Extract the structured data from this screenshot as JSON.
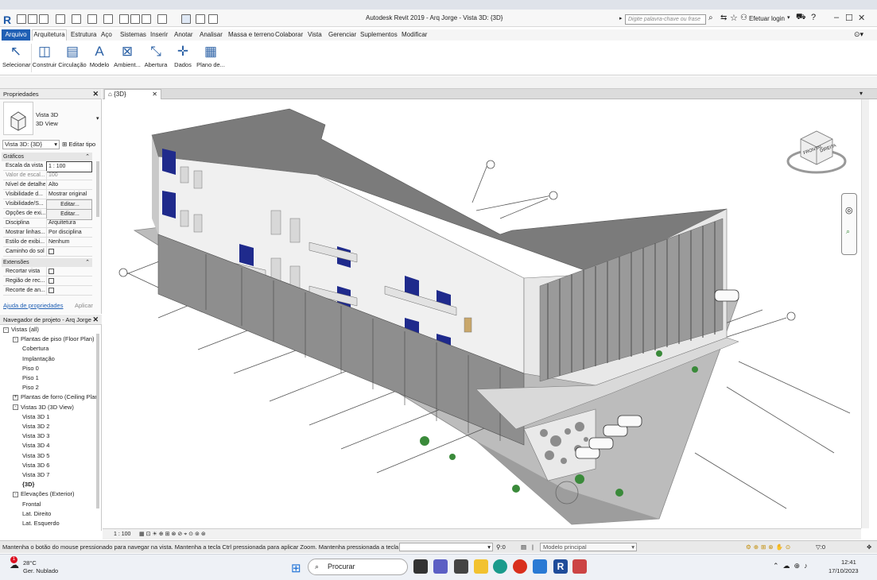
{
  "window": {
    "title": "Autodesk Revit 2019 - Arq Jorge - Vista 3D: {3D}",
    "search_placeholder": "Digite palavra-chave ou frase",
    "login": "Efetuar login"
  },
  "menu": {
    "items": [
      "Arquivo",
      "Arquitetura",
      "Estrutura",
      "Aço",
      "Sistemas",
      "Inserir",
      "Anotar",
      "Analisar",
      "Massa e terreno",
      "Colaborar",
      "Vista",
      "Gerenciar",
      "Suplementos",
      "Modificar"
    ]
  },
  "ribbon": {
    "buttons": [
      {
        "label": "Selecionar",
        "icon": "cursor-icon"
      },
      {
        "label": "Construir",
        "icon": "wall-icon"
      },
      {
        "label": "Circulação",
        "icon": "stair-icon"
      },
      {
        "label": "Modelo",
        "icon": "model-text-icon"
      },
      {
        "label": "Ambient...",
        "icon": "room-icon"
      },
      {
        "label": "Abertura",
        "icon": "opening-icon"
      },
      {
        "label": "Dados",
        "icon": "datum-icon"
      },
      {
        "label": "Plano de...",
        "icon": "work-plane-icon"
      }
    ]
  },
  "properties": {
    "title": "Propriedades",
    "type_name": "Vista 3D",
    "type_sub": "3D View",
    "selector": "Vista 3D: {3D}",
    "edit_type": "Editar tipo",
    "section_graphics": "Gráficos",
    "rows": [
      {
        "k": "Escala da vista",
        "v": "1 : 100"
      },
      {
        "k": "Valor de escal...",
        "v": "100"
      },
      {
        "k": "Nível de detalhe",
        "v": "Alto"
      },
      {
        "k": "Visibilidade d...",
        "v": "Mostrar original"
      },
      {
        "k": "Visibilidade/S...",
        "v": "Editar..."
      },
      {
        "k": "Opções de exi...",
        "v": "Editar..."
      },
      {
        "k": "Disciplina",
        "v": "Arquitetura"
      },
      {
        "k": "Mostrar linhas...",
        "v": "Por disciplina"
      },
      {
        "k": "Estilo de exibi...",
        "v": "Nenhum"
      },
      {
        "k": "Caminho do sol",
        "v": ""
      }
    ],
    "section_extents": "Extensões",
    "ext_rows": [
      "Recortar vista",
      "Região de rec...",
      "Recorte de an..."
    ],
    "help_link": "Ajuda de propriedades",
    "apply": "Aplicar"
  },
  "navigator": {
    "title": "Navegador de projeto - Arq Jorge",
    "tree": [
      {
        "label": "Vistas (all)",
        "level": 0,
        "toggle": "-"
      },
      {
        "label": "Plantas de piso (Floor Plan)",
        "level": 1,
        "toggle": "-"
      },
      {
        "label": "Cobertura",
        "level": 2
      },
      {
        "label": "Implantação",
        "level": 2
      },
      {
        "label": "Piso 0",
        "level": 2
      },
      {
        "label": "Piso 1",
        "level": 2
      },
      {
        "label": "Piso 2",
        "level": 2
      },
      {
        "label": "Plantas de forro (Ceiling Plan",
        "level": 1,
        "toggle": "+"
      },
      {
        "label": "Vistas 3D (3D View)",
        "level": 1,
        "toggle": "-"
      },
      {
        "label": "Vista 3D 1",
        "level": 2
      },
      {
        "label": "Vista 3D 2",
        "level": 2
      },
      {
        "label": "Vista 3D 3",
        "level": 2
      },
      {
        "label": "Vista 3D 4",
        "level": 2
      },
      {
        "label": "Vista 3D 5",
        "level": 2
      },
      {
        "label": "Vista 3D 6",
        "level": 2
      },
      {
        "label": "Vista 3D 7",
        "level": 2
      },
      {
        "label": "{3D}",
        "level": 2,
        "bold": true
      },
      {
        "label": "Elevações (Exterior)",
        "level": 1,
        "toggle": "-"
      },
      {
        "label": "Frontal",
        "level": 2
      },
      {
        "label": "Lat. Direito",
        "level": 2
      },
      {
        "label": "Lat. Esquerdo",
        "level": 2
      }
    ]
  },
  "view": {
    "tab": "{3D}",
    "scale": "1 : 100",
    "viewcube_front": "FRONTAL",
    "viewcube_right": "DIREITA"
  },
  "status": {
    "message": "Mantenha o botão do mouse pressionado para navegar na vista. Mantenha a tecla Ctrl pressionada para aplicar Zoom. Mantenha pressionada a tecla Shift para",
    "selection_count": ":0",
    "model": "Modelo principal",
    "filter_count": ":0"
  },
  "taskbar": {
    "weather_temp": "28°C",
    "weather_desc": "Ger. Nublado",
    "weather_badge": "1",
    "search": "Procurar",
    "time": "12:41",
    "date": "17/10/2023"
  },
  "colors": {
    "accent": "#1f5fb4",
    "glass": "#1f2a8c"
  }
}
